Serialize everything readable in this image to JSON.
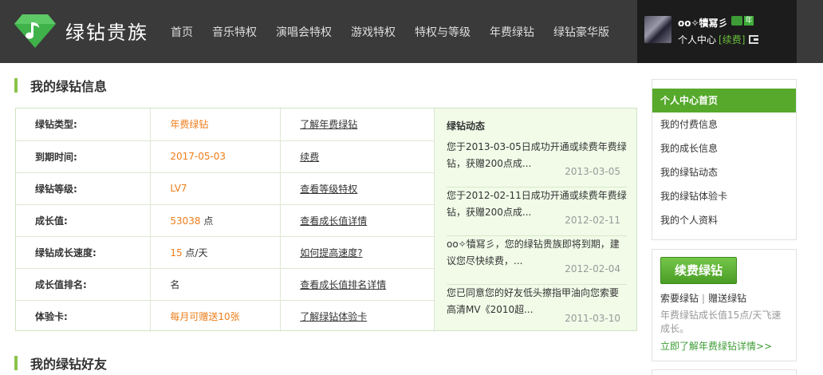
{
  "brand": {
    "name": "绿钻贵族"
  },
  "nav": [
    "首页",
    "音乐特权",
    "演唱会特权",
    "游戏特权",
    "特权与等级",
    "年费绿钻",
    "绿钻豪华版"
  ],
  "user": {
    "name": "oo✧犢冩彡",
    "center": "个人中心",
    "renew": "[续费]",
    "badge": "年"
  },
  "info_section": {
    "title": "我的绿钻信息"
  },
  "info_rows": [
    {
      "label": "绿钻类型:",
      "value": "年费绿钻",
      "unit": "",
      "link": "了解年费绿钻"
    },
    {
      "label": "到期时间:",
      "value": "2017-05-03",
      "unit": "",
      "link": "续费"
    },
    {
      "label": "绿钻等级:",
      "value": "LV7",
      "unit": "",
      "link": "查看等级特权"
    },
    {
      "label": "成长值:",
      "value": "53038",
      "unit": " 点",
      "link": "查看成长值详情"
    },
    {
      "label": "绿钻成长速度:",
      "value": "15",
      "unit": " 点/天",
      "link": "如何提高速度?"
    },
    {
      "label": "成长值排名:",
      "value": "名",
      "unit": "",
      "link": "查看成长值排名详情"
    },
    {
      "label": "体验卡:",
      "value": "每月可赠送10张",
      "unit": "",
      "link": "了解绿钻体验卡"
    }
  ],
  "news": {
    "title": "绿钻动态",
    "items": [
      {
        "text": "您于2013-03-05日成功开通或续费年费绿钻，获赠200点成...",
        "date": "2013-03-05"
      },
      {
        "text": "您于2012-02-11日成功开通或续费年费绿钻，获赠200点成...",
        "date": "2012-02-11"
      },
      {
        "text": "oo✧犢冩彡，您的绿钻贵族即将到期，建议您尽快续费，...",
        "date": "2012-02-04"
      },
      {
        "text": "您已同意您的好友低头擦指甲油向您索要高清MV《2010超...",
        "date": "2011-03-10"
      }
    ]
  },
  "friends_section": {
    "title": "我的绿钻好友"
  },
  "sidebar": {
    "items": [
      "个人中心首页",
      "我的付费信息",
      "我的成长信息",
      "我的绿钻动态",
      "我的绿钻体验卡",
      "我的个人资料"
    ]
  },
  "renew_box": {
    "button": "续费绿钻",
    "link_request": "索要绿钻",
    "separator": "|",
    "link_gift": "赠送绿钻",
    "desc": "年费绿钻成长值15点/天飞速成长。",
    "more": "立即了解年费绿钻详情>>"
  },
  "colors": {
    "accent": "#56a92b",
    "value": "#ef7d1a",
    "topbar": "#3a3a3a"
  }
}
